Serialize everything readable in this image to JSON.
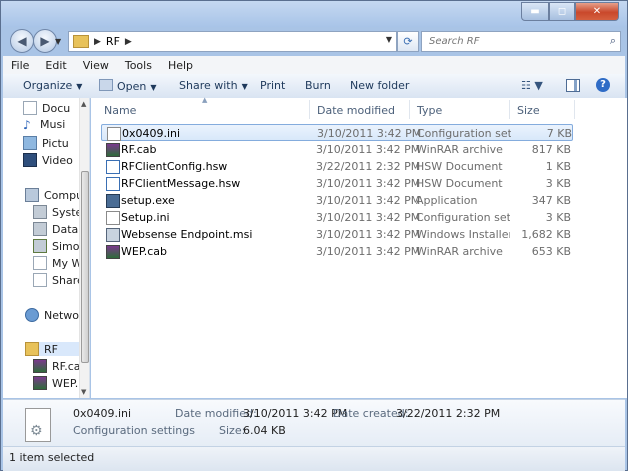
{
  "window": {
    "title": "",
    "controls": {
      "minimize_icon": "minimize-icon",
      "maximize_icon": "maximize-icon",
      "close_icon": "close-icon"
    }
  },
  "address": {
    "crumbs": [
      "RF"
    ],
    "search_placeholder": "Search RF"
  },
  "menu": [
    "File",
    "Edit",
    "View",
    "Tools",
    "Help"
  ],
  "toolbar": {
    "organize": "Organize",
    "open": "Open",
    "share_with": "Share with",
    "print": "Print",
    "burn": "Burn",
    "new_folder": "New folder"
  },
  "nav": {
    "libraries": [
      "Docu",
      "Musi",
      "Pictu",
      "Video"
    ],
    "computer": "Compu",
    "computer_items": [
      "Syste",
      "Data",
      "Simo",
      "My W",
      "Share"
    ],
    "network": "Netwo",
    "current_folder": "RF",
    "folder_items": [
      "RF.ca",
      "WEP."
    ]
  },
  "columns": {
    "name": "Name",
    "date": "Date modified",
    "type": "Type",
    "size": "Size"
  },
  "files": [
    {
      "name": "0x0409.ini",
      "date": "3/10/2011 3:42 PM",
      "type": "Configuration sett...",
      "size": "7 KB",
      "icon": "ini-file-icon",
      "selected": true
    },
    {
      "name": "RF.cab",
      "date": "3/10/2011 3:42 PM",
      "type": "WinRAR archive",
      "size": "817 KB",
      "icon": "winrar-archive-icon"
    },
    {
      "name": "RFClientConfig.hsw",
      "date": "3/22/2011 2:32 PM",
      "type": "HSW Document",
      "size": "1 KB",
      "icon": "document-icon"
    },
    {
      "name": "RFClientMessage.hsw",
      "date": "3/10/2011 3:42 PM",
      "type": "HSW Document",
      "size": "3 KB",
      "icon": "document-icon"
    },
    {
      "name": "setup.exe",
      "date": "3/10/2011 3:42 PM",
      "type": "Application",
      "size": "347 KB",
      "icon": "setup-exe-icon"
    },
    {
      "name": "Setup.ini",
      "date": "3/10/2011 3:42 PM",
      "type": "Configuration sett...",
      "size": "3 KB",
      "icon": "ini-file-icon"
    },
    {
      "name": "Websense Endpoint.msi",
      "date": "3/10/2011 3:42 PM",
      "type": "Windows Installer ...",
      "size": "1,682 KB",
      "icon": "msi-installer-icon"
    },
    {
      "name": "WEP.cab",
      "date": "3/10/2011 3:42 PM",
      "type": "WinRAR archive",
      "size": "653 KB",
      "icon": "winrar-archive-icon"
    }
  ],
  "details": {
    "name": "0x0409.ini",
    "type": "Configuration settings",
    "date_modified_label": "Date modified:",
    "date_modified": "3/10/2011 3:42 PM",
    "date_created_label": "Date created:",
    "date_created": "3/22/2011 2:32 PM",
    "size_label": "Size:",
    "size": "6.04 KB"
  },
  "status": "1 item selected",
  "colors": {
    "accent": "#3a6fb3",
    "selection": "#d8e8fa",
    "frame": "#a9c4e6"
  }
}
